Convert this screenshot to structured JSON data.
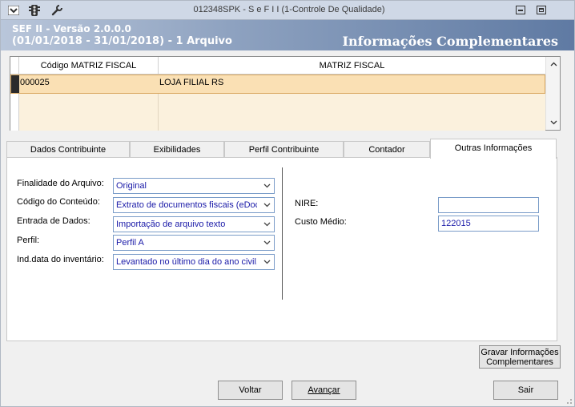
{
  "window": {
    "title": "012348SPK - S e F  I I (1-Controle De Qualidade)"
  },
  "header": {
    "version": "SEF II - Versão 2.0.0.0",
    "period": "(01/01/2018 - 31/01/2018) - 1 Arquivo",
    "page_title": "Informações Complementares"
  },
  "grid": {
    "columns": [
      "Código MATRIZ FISCAL",
      "MATRIZ FISCAL"
    ],
    "rows": [
      {
        "code": "000025",
        "name": "LOJA FILIAL RS"
      }
    ]
  },
  "tabs": [
    {
      "label": "Dados Contribuinte",
      "active": false
    },
    {
      "label": "Exibilidades",
      "active": false
    },
    {
      "label": "Perfil Contribuinte",
      "active": false
    },
    {
      "label": "Contador",
      "active": false
    },
    {
      "label": "Outras Informações",
      "active": true
    }
  ],
  "form": {
    "finalidade": {
      "label": "Finalidade do Arquivo:",
      "value": "Original"
    },
    "conteudo": {
      "label": "Código do Conteúdo:",
      "value": "Extrato de documentos fiscais (eDoc)"
    },
    "entrada": {
      "label": "Entrada de Dados:",
      "value": "Importação de arquivo texto"
    },
    "perfil": {
      "label": "Perfil:",
      "value": "Perfil A"
    },
    "inventario": {
      "label": "Ind.data do inventário:",
      "value": "Levantado no último dia do ano civil, c"
    },
    "nire": {
      "label": "NIRE:",
      "value": ""
    },
    "custo": {
      "label": "Custo Médio:",
      "value": "122015"
    }
  },
  "buttons": {
    "save_line1": "Gravar Informações",
    "save_line2": "Complementares",
    "back": "Voltar",
    "next": "Avançar",
    "exit": "Sair"
  },
  "colors": {
    "selected_row": "#fae0b4",
    "header_gradient_end": "#5f7aa3",
    "field_text": "#1a1aa8"
  }
}
